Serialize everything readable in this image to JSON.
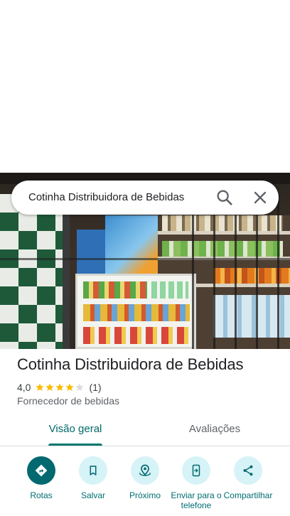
{
  "search": {
    "query": "Cotinha Distribuidora de Bebidas"
  },
  "place": {
    "name": "Cotinha Distribuidora de Bebidas",
    "rating": "4,0",
    "stars": 4,
    "max_stars": 5,
    "review_count": "(1)",
    "category": "Fornecedor de bebidas"
  },
  "tabs": [
    {
      "label": "Visão geral",
      "selected": true
    },
    {
      "label": "Avaliações",
      "selected": false
    }
  ],
  "actions": [
    {
      "label": "Rotas",
      "icon": "directions-icon"
    },
    {
      "label": "Salvar",
      "icon": "bookmark-icon"
    },
    {
      "label": "Próximo",
      "icon": "nearby-icon"
    },
    {
      "label": "Enviar para o telefone",
      "icon": "send-to-phone-icon"
    },
    {
      "label": "Compartilhar",
      "icon": "share-icon"
    }
  ],
  "colors": {
    "accent": "#006a6a",
    "action_bg": "#d6f3f7",
    "primary_action": "#01696f",
    "star": "#fbbc04"
  }
}
